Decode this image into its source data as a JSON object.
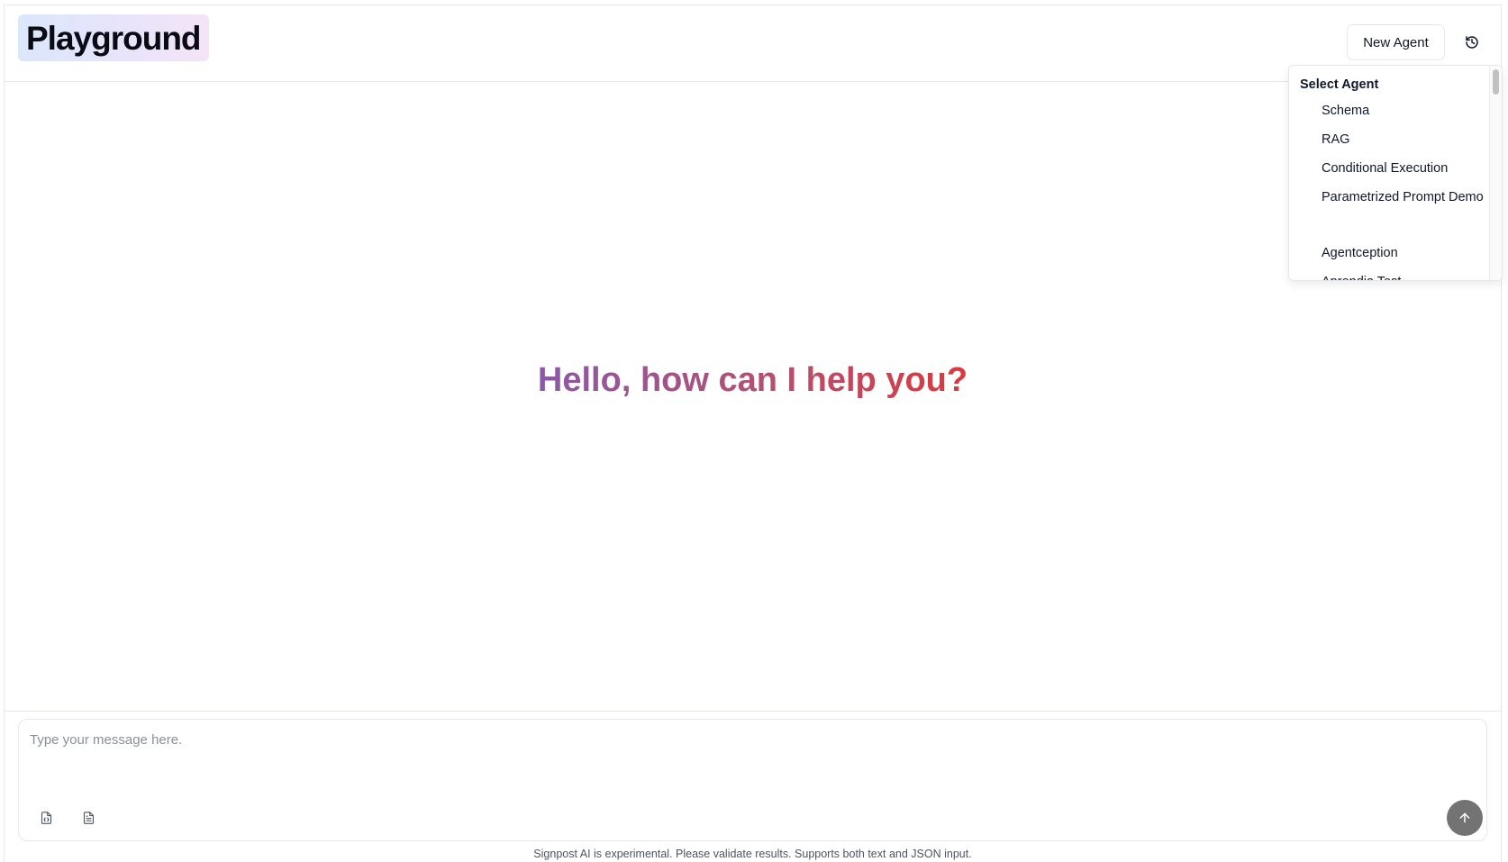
{
  "header": {
    "title": "Playground",
    "new_agent_label": "New Agent",
    "history_icon": "history-icon"
  },
  "agent_dropdown": {
    "label": "Select Agent",
    "items": [
      {
        "label": "Schema"
      },
      {
        "label": "RAG"
      },
      {
        "label": "Conditional Execution"
      },
      {
        "label": "Parametrized Prompt Demo"
      },
      {
        "label": "Agentception"
      },
      {
        "label": "Aprendia Test"
      }
    ]
  },
  "main": {
    "greeting": "Hello, how can I help you?"
  },
  "composer": {
    "placeholder": "Type your message here.",
    "value": "",
    "tools": [
      "json-file-icon",
      "text-file-icon"
    ],
    "send_icon": "arrow-up-icon"
  },
  "footer": {
    "note": "Signpost AI is experimental. Please validate results. Supports both text and JSON input."
  },
  "colors": {
    "greeting_start": "#8c58a8",
    "greeting_end": "#d93a3e",
    "send_button": "#737373",
    "logo_gradient_start": "#dbe7fb",
    "logo_gradient_end": "#f5e4f7"
  }
}
